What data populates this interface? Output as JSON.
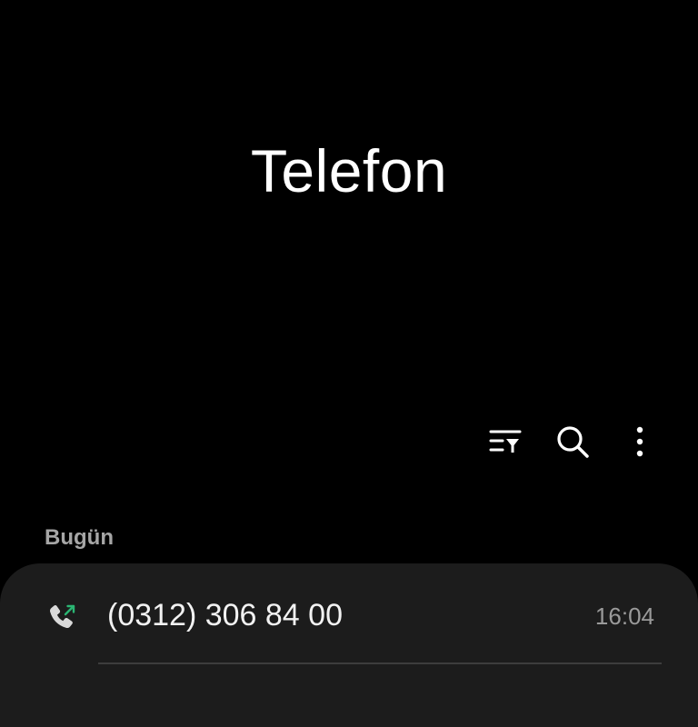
{
  "app": {
    "title": "Telefon"
  },
  "toolbar": {
    "filter_icon": "filter-list-icon",
    "search_icon": "search-icon",
    "more_icon": "more-vertical-icon"
  },
  "call_log": {
    "section_label": "Bugün",
    "entries": [
      {
        "number": "(0312) 306 84 00",
        "time": "16:04",
        "type": "outgoing",
        "icon": "outgoing-call-icon"
      }
    ]
  },
  "colors": {
    "background": "#000000",
    "card": "#1c1c1c",
    "outgoing_arrow": "#2bb673",
    "secondary_text": "#9a9a9a"
  }
}
